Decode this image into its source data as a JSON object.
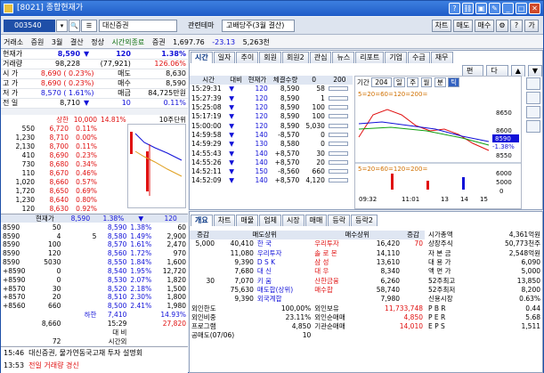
{
  "window": {
    "title": "[8021] 종합현재가"
  },
  "toolbar": {
    "code": "003540",
    "name": "대신증권",
    "theme_label": "관련테마",
    "theme": "고배당주(3월 결산)",
    "btn_chart": "차트",
    "btn_sell": "매도",
    "btn_buy": "매수",
    "btn_q": "?",
    "btn_ga": "가"
  },
  "infobar": {
    "items": [
      "거래소",
      "증원",
      "3월",
      "결산",
      "정상"
    ],
    "status": "시간외종료",
    "index_label": "증권",
    "index_value": "1,697.76",
    "index_change": "-23.13",
    "volume": "5,263천"
  },
  "summary": [
    {
      "k": "현재가",
      "v": "8,590",
      "arrow": "▼",
      "c": "120",
      "p": "1.38%"
    },
    {
      "k": "거래량",
      "v": "98,228",
      "v2": "(77,921)",
      "p": "126.06%"
    },
    {
      "k": "시  가",
      "v": "8,690 ( 0.23%)",
      "k2": "매도",
      "v3": "8,630"
    },
    {
      "k": "고  가",
      "v": "8,690 ( 0.23%)",
      "k2": "매수",
      "v3": "8,590"
    },
    {
      "k": "저  가",
      "v": "8,570 ( 1.61%)",
      "k2": "매금",
      "v3": "84,725만원"
    },
    {
      "k": "전  일",
      "v": "8,710",
      "arrow": "▼",
      "c": "10",
      "p": "0.11%"
    }
  ],
  "hoga_top": {
    "label": "상한",
    "price": "10,000",
    "pct": "14.81%",
    "note": "10주단위"
  },
  "hoga": [
    [
      "550",
      "6,720",
      "0.11%"
    ],
    [
      "1,230",
      "8,710",
      "0.00%"
    ],
    [
      "2,130",
      "8,700",
      "0.11%"
    ],
    [
      "410",
      "8,690",
      "0.23%"
    ],
    [
      "730",
      "8,680",
      "0.34%"
    ],
    [
      "110",
      "8,670",
      "0.46%"
    ],
    [
      "1,020",
      "8,660",
      "0.57%"
    ],
    [
      "1,720",
      "8,650",
      "0.69%"
    ],
    [
      "1,230",
      "8,640",
      "0.80%"
    ],
    [
      "120",
      "8,630",
      "0.92%"
    ]
  ],
  "bottom": {
    "headers": [
      "",
      "현재가",
      "8,590",
      "1.38%",
      "▼",
      "120"
    ],
    "rows": [
      [
        "8590",
        "50",
        "",
        "8,590",
        "1.38%",
        "60"
      ],
      [
        "8590",
        "4",
        "5",
        "8,580",
        "1.49%",
        "2,900"
      ],
      [
        "8590",
        "100",
        "",
        "8,570",
        "1.61%",
        "2,470"
      ],
      [
        "8590",
        "120",
        "",
        "8,560",
        "1.72%",
        "970"
      ],
      [
        "8590",
        "5030",
        "",
        "8,550",
        "1.84%",
        "1,600"
      ],
      [
        "+8590",
        "0",
        "",
        "8,540",
        "1.95%",
        "12,720"
      ],
      [
        "+8590",
        "0",
        "",
        "8,530",
        "2.07%",
        "1,820"
      ],
      [
        "+8570",
        "30",
        "",
        "8,520",
        "2.18%",
        "1,500"
      ],
      [
        "+8570",
        "20",
        "",
        "8,510",
        "2.30%",
        "1,800"
      ],
      [
        "+8560",
        "660",
        "",
        "8,500",
        "2.41%",
        "1,980"
      ]
    ],
    "lower": {
      "label": "하한",
      "price": "7,410",
      "pct": "14.93%"
    },
    "tot": [
      "8,660",
      "15:29",
      "27,820"
    ],
    "extra": [
      "대  비"
    ],
    "after": [
      "72",
      "시간외"
    ]
  },
  "news": [
    {
      "t": "15:46",
      "txt": "대신증권, 물가연동국고채 투자 설명회"
    },
    {
      "t": "13:53",
      "txt": "전일 거래량 경신"
    }
  ],
  "tabs_top": [
    "시간",
    "일자",
    "추이",
    "회원",
    "회원2",
    "관심",
    "뉴스",
    "리포트",
    "기업",
    "수급",
    "재무"
  ],
  "tick_headers": [
    "시간",
    "대비",
    "현재가",
    "체결수량",
    "0",
    "200"
  ],
  "ticks": [
    [
      "15:29:31",
      "▼",
      "120",
      "8,590",
      "58"
    ],
    [
      "15:27:39",
      "▼",
      "120",
      "8,590",
      "1"
    ],
    [
      "15:25:08",
      "▼",
      "120",
      "8,590",
      "100"
    ],
    [
      "15:17:19",
      "▼",
      "120",
      "8,590",
      "100"
    ],
    [
      "15:00:00",
      "▼",
      "120",
      "8,590",
      "5,030"
    ],
    [
      "14:59:58",
      "▼",
      "140",
      "-8,570",
      "0"
    ],
    [
      "14:59:29",
      "▼",
      "130",
      "8,580",
      "0"
    ],
    [
      "14:55:43",
      "▼",
      "140",
      "+8,570",
      "30"
    ],
    [
      "14:55:26",
      "▼",
      "140",
      "+8,570",
      "20"
    ],
    [
      "14:52:11",
      "▼",
      "150",
      "-8,560",
      "660"
    ],
    [
      "14:52:09",
      "▼",
      "140",
      "+8,570",
      "4,120"
    ]
  ],
  "ichart": {
    "period_label": "기간",
    "period": "204",
    "btns": [
      "일",
      "주",
      "월",
      "분",
      "틱"
    ],
    "ma": "5=20=60=120=200=",
    "ma2": "5=20=60=120=200=",
    "yvals": [
      "8650",
      "8600",
      "8590",
      "8550"
    ],
    "pct": "-1.38%",
    "vals2": [
      "6000",
      "5000",
      "0"
    ],
    "xlab": [
      "09:32",
      "11:01",
      "13",
      "14",
      "15"
    ]
  },
  "edit_btns": [
    "편집",
    "다음"
  ],
  "tabs_bot": [
    "개요",
    "차트",
    "매물",
    "업체",
    "시장",
    "매매",
    "등락",
    "등락2"
  ],
  "trader_headers": [
    "증감",
    "매도상위",
    "매수상위",
    "증감"
  ],
  "traders": [
    [
      "5,000",
      "40,410",
      "한 국",
      "우리투자",
      "16,420",
      "70"
    ],
    [
      "",
      "11,080",
      "우리투자",
      "솔 로 몬",
      "14,110",
      ""
    ],
    [
      "",
      "9,390",
      "D S K",
      "삼 성",
      "13,610",
      ""
    ],
    [
      "",
      "7,680",
      "대 신",
      "대 우",
      "8,340",
      ""
    ],
    [
      "30",
      "7,070",
      "키 움",
      "산한금융",
      "6,260",
      ""
    ],
    [
      "",
      "75,630",
      "매도합(상위)",
      "매수합",
      "58,740",
      ""
    ],
    [
      "",
      "9,390",
      "외국계합",
      "",
      "7,980",
      ""
    ]
  ],
  "trader_misc": [
    [
      "외인한도",
      "100,00%",
      "외인보유",
      "11,733,748"
    ],
    [
      "외인비중",
      "23.11%",
      "외인순매매",
      "4,850"
    ],
    [
      "프로그램",
      "4,850",
      "기관순매매",
      "14,010"
    ],
    [
      "공매도(07/06)",
      "10",
      "",
      ""
    ]
  ],
  "fin": [
    [
      "시가총액",
      "4,361억원"
    ],
    [
      "상장주식",
      "50,773천주"
    ],
    [
      "자 본 금",
      "2,548억원"
    ],
    [
      "대 용 가",
      "6,090"
    ],
    [
      "액 면 가",
      "5,000"
    ],
    [
      "52주최고",
      "13,850"
    ],
    [
      "52주최저",
      "8,200"
    ],
    [
      "신용시장",
      "0.63%"
    ],
    [
      "P  B  R",
      "0.44"
    ],
    [
      "P  E  R",
      "5.68"
    ],
    [
      "E  P  S",
      "1,511"
    ]
  ]
}
